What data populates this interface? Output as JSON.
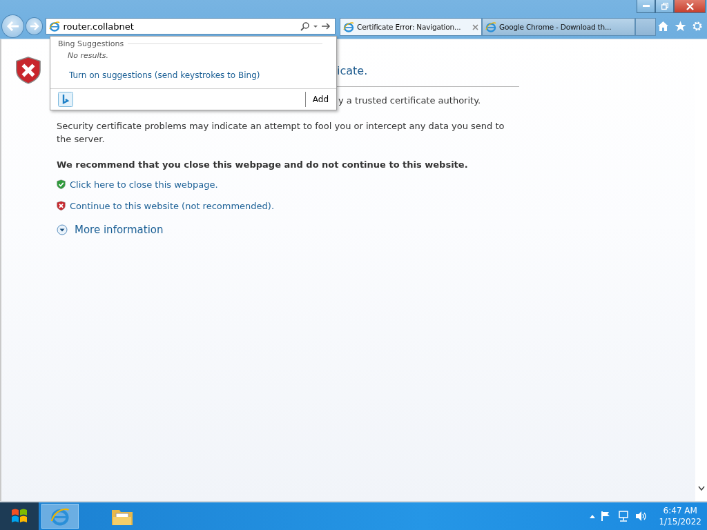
{
  "address_bar": {
    "value": "router.collabnet"
  },
  "tabs": [
    {
      "label": "Certificate Error: Navigation...",
      "selected": true,
      "closable": true
    },
    {
      "label": "Google Chrome - Download th...",
      "selected": false,
      "closable": false
    }
  ],
  "suggestions": {
    "heading": "Bing Suggestions",
    "empty_text": "No results.",
    "link": "Turn on suggestions (send keystrokes to Bing)",
    "add_button": "Add"
  },
  "page": {
    "heading_fragment": "icate.",
    "intro_fragment": "y a trusted certificate authority.",
    "warning": "Security certificate problems may indicate an attempt to fool you or intercept any data you send to the server.",
    "recommendation": "We recommend that you close this webpage and do not continue to this website.",
    "links": [
      {
        "kind": "safe",
        "label": "Click here to close this webpage."
      },
      {
        "kind": "unsafe",
        "label": "Continue to this website (not recommended)."
      }
    ],
    "more_info": "More information"
  },
  "taskbar": {
    "time": "6:47 AM",
    "date": "1/15/2022",
    "apps": [
      {
        "kind": "browser",
        "selected": true
      },
      {
        "kind": "folder",
        "selected": false
      }
    ]
  }
}
